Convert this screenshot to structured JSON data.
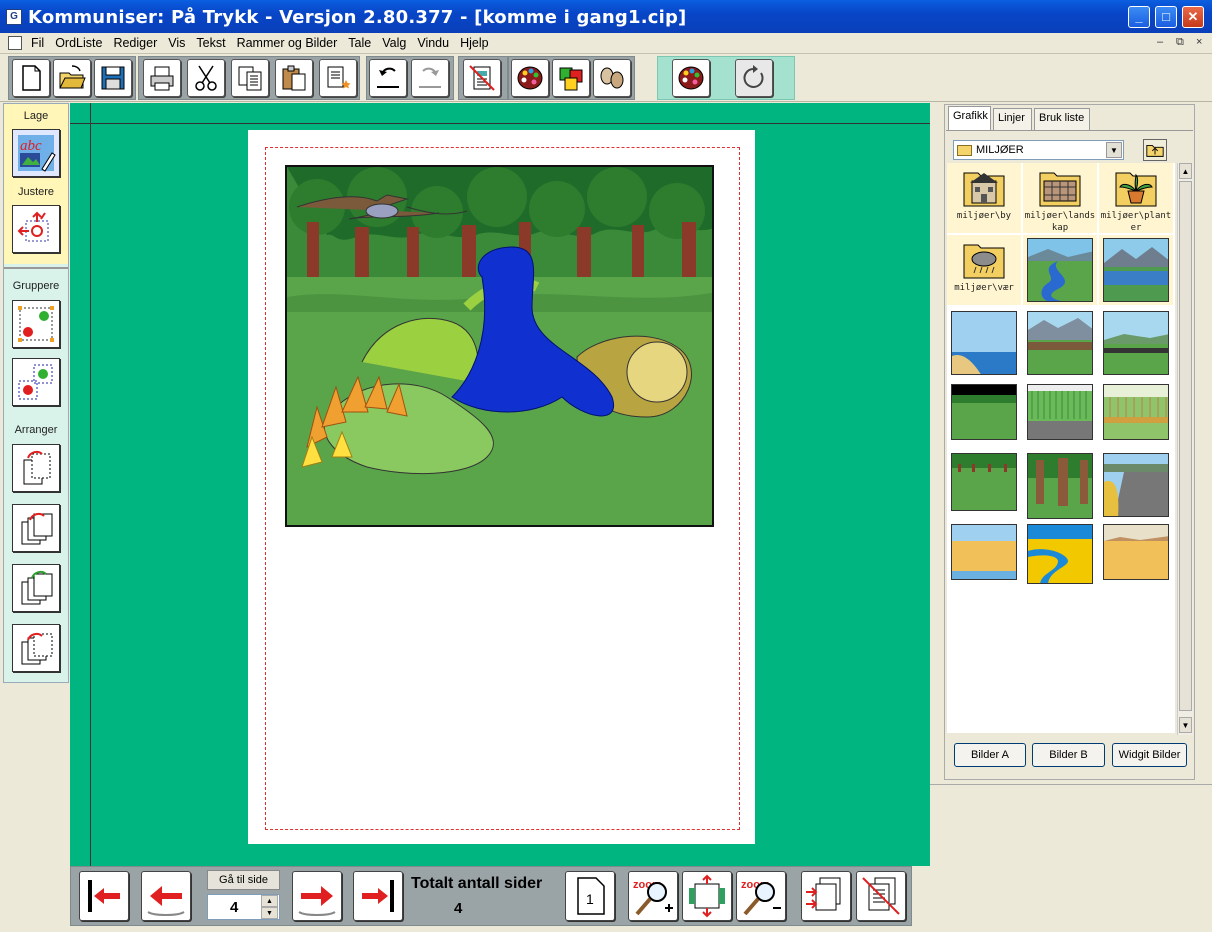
{
  "window": {
    "title": "Kommuniser: På Trykk - Versjon 2.80.377 - [komme i gang1.cip]",
    "minimize": "_",
    "maximize": "□",
    "close": "✕"
  },
  "menu": [
    "Fil",
    "OrdListe",
    "Rediger",
    "Vis",
    "Tekst",
    "Rammer og Bilder",
    "Tale",
    "Valg",
    "Vindu",
    "Hjelp"
  ],
  "mdi_controls": [
    "–",
    "⧉",
    "×"
  ],
  "toolbar": {
    "buttons": [
      "new-document",
      "open-folder",
      "save-disk",
      "print",
      "cut-scissors",
      "copy",
      "paste",
      "paste-special",
      "undo",
      "redo",
      "spell-check-off",
      "colour-palette",
      "colour-squares",
      "eggs",
      "colour-palette-2",
      "refresh"
    ]
  },
  "left_tools": {
    "sections": {
      "lage": "Lage",
      "justere": "Justere",
      "gruppere": "Gruppere",
      "arranger": "Arranger"
    },
    "abc_text": "abc"
  },
  "right_panel": {
    "tabs": [
      "Grafikk",
      "Linjer",
      "Bruk liste"
    ],
    "active_tab": "Grafikk",
    "folder": "MILJØER",
    "folders": [
      {
        "label": "miljøer\\by"
      },
      {
        "label": "miljøer\\landskap"
      },
      {
        "label": "miljøer\\planter"
      },
      {
        "label": "miljøer\\vær"
      }
    ],
    "buttons": [
      "Bilder A",
      "Bilder B",
      "Widgit Bilder"
    ]
  },
  "bottom_bar": {
    "goto_label": "Gå til side",
    "goto_value": "4",
    "total_label": "Totalt antall sider",
    "total_value": "4",
    "single_page_num": "1",
    "zoom_text": "zoom"
  },
  "colors": {
    "canvas": "#00b57f",
    "accent_teal": "#a4e2cf",
    "title_blue": "#0a5fe0",
    "arrow_red": "#e02020"
  }
}
